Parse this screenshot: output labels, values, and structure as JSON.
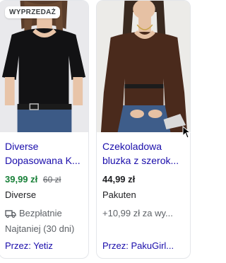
{
  "products": [
    {
      "badge": "WYPRZEDAŻ",
      "title_line1": "Diverse",
      "title_line2": "Dopasowana K...",
      "price": "39,99 zł",
      "old_price": "60 zł",
      "merchant": "Diverse",
      "shipping": "Bezpłatnie",
      "lowest_price_note": "Najtaniej (30 dni)",
      "seller": "Przez: Yetiz"
    },
    {
      "title_line1": "Czekoladowa",
      "title_line2": "bluzka z szerok...",
      "price": "44,99 zł",
      "merchant": "Pakuten",
      "shipping": "+10,99 zł za wy...",
      "seller": "Przez: PakuGirl..."
    }
  ],
  "colors": {
    "link": "#1a0dab",
    "sale_price": "#188038",
    "muted": "#5f6368"
  }
}
